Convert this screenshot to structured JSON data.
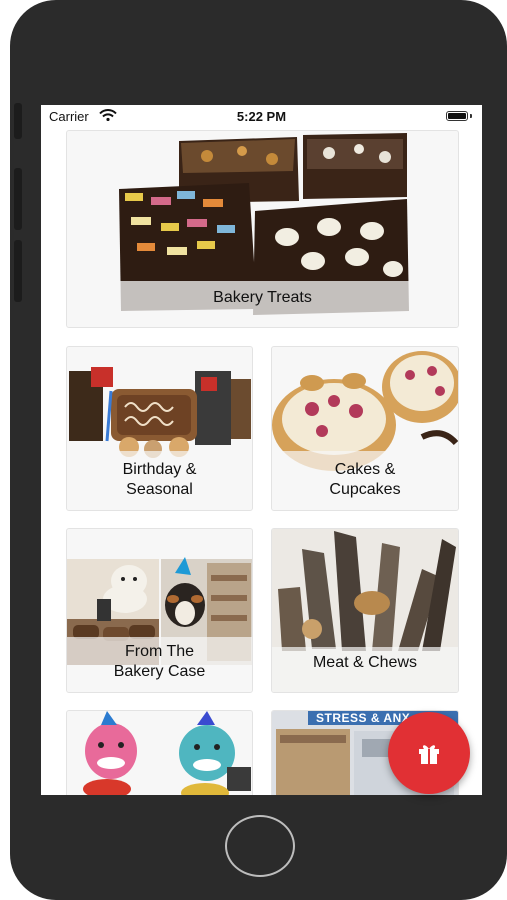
{
  "status_bar": {
    "carrier": "Carrier",
    "time": "5:22 PM"
  },
  "categories": [
    {
      "label": "Bakery Treats"
    },
    {
      "label": "Birthday &\nSeasonal"
    },
    {
      "label": "Cakes &\nCupcakes"
    },
    {
      "label": "From The\nBakery Case"
    },
    {
      "label": "Meat & Chews"
    },
    {
      "label": ""
    },
    {
      "label": ""
    }
  ],
  "partial_banner_text": "STRESS & ANX",
  "fab": {
    "icon": "gift-icon"
  },
  "colors": {
    "fab": "#e13034",
    "phone_bezel": "#2b2b2b"
  }
}
